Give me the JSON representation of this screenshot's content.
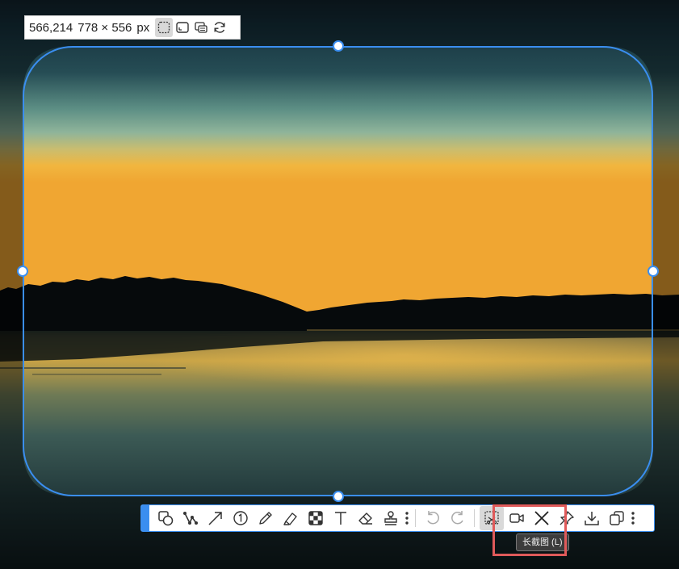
{
  "info_bar": {
    "position_text": "566,214",
    "size_text": "778 × 556",
    "unit_text": "px",
    "mode_buttons": [
      {
        "icon": "rect-select-icon",
        "active": true
      },
      {
        "icon": "window-select-icon",
        "active": false
      },
      {
        "icon": "screen-select-icon",
        "active": false
      },
      {
        "icon": "refresh-icon",
        "active": false
      }
    ]
  },
  "toolbar": {
    "tools": [
      "shape-icon",
      "polyline-icon",
      "arrow-icon",
      "number-marker-icon",
      "pencil-icon",
      "highlighter-icon",
      "mosaic-icon",
      "text-icon",
      "eraser-icon",
      "stamp-icon"
    ],
    "history": [
      "undo-icon",
      "redo-icon"
    ],
    "actions": [
      "long-screenshot-icon",
      "record-video-icon",
      "close-icon",
      "pin-icon",
      "download-icon",
      "copy-icon"
    ],
    "active_action": "long-screenshot-icon"
  },
  "tooltip": {
    "text": "长截图 (L)"
  },
  "colors": {
    "accent": "#3a8ef0",
    "highlight": "#e05a5a",
    "sky_top": "#16313e",
    "sky_mid": "#7fb0a0",
    "horizon": "#f0b640"
  }
}
